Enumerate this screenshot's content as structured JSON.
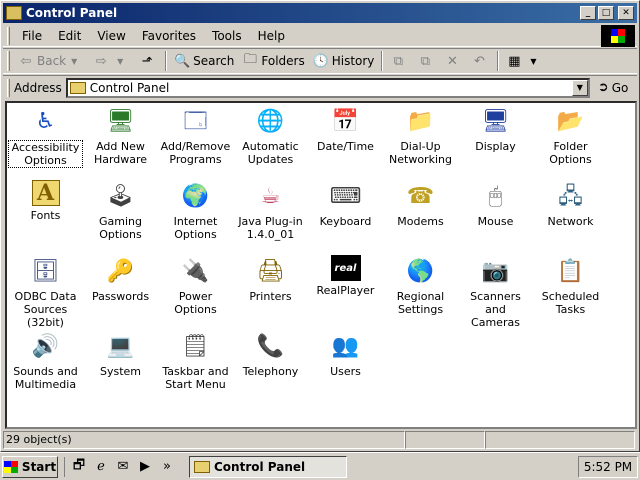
{
  "window": {
    "title": "Control Panel",
    "minimize": "_",
    "maximize": "□",
    "close": "✕"
  },
  "menu": [
    "File",
    "Edit",
    "View",
    "Favorites",
    "Tools",
    "Help"
  ],
  "toolbar": {
    "back": "Back",
    "search": "Search",
    "folders": "Folders",
    "history": "History"
  },
  "address": {
    "label": "Address",
    "value": "Control Panel",
    "go": "Go"
  },
  "icons": [
    {
      "label": "Accessibility Options",
      "glyph": "♿",
      "color": "#1a4fc0"
    },
    {
      "label": "Add New Hardware",
      "glyph": "🖥",
      "color": "#2a7a2a"
    },
    {
      "label": "Add/Remove Programs",
      "glyph": "🗔",
      "color": "#3050a0"
    },
    {
      "label": "Automatic Updates",
      "glyph": "🌐",
      "color": "#2070c0"
    },
    {
      "label": "Date/Time",
      "glyph": "📅",
      "color": "#a02020"
    },
    {
      "label": "Dial-Up Networking",
      "glyph": "📁",
      "color": "#c0a020"
    },
    {
      "label": "Display",
      "glyph": "🖥",
      "color": "#2040a0"
    },
    {
      "label": "Folder Options",
      "glyph": "📂",
      "color": "#c0a020"
    },
    {
      "label": "Fonts",
      "glyph": "A",
      "color": "#806000"
    },
    {
      "label": "Gaming Options",
      "glyph": "🕹",
      "color": "#404040"
    },
    {
      "label": "Internet Options",
      "glyph": "🌍",
      "color": "#2070c0"
    },
    {
      "label": "Java Plug-in 1.4.0_01",
      "glyph": "☕",
      "color": "#c04060"
    },
    {
      "label": "Keyboard",
      "glyph": "⌨",
      "color": "#404040"
    },
    {
      "label": "Modems",
      "glyph": "☎",
      "color": "#c0a020"
    },
    {
      "label": "Mouse",
      "glyph": "🖱",
      "color": "#606060"
    },
    {
      "label": "Network",
      "glyph": "🖧",
      "color": "#306080"
    },
    {
      "label": "ODBC Data Sources (32bit)",
      "glyph": "🗄",
      "color": "#405080"
    },
    {
      "label": "Passwords",
      "glyph": "🔑",
      "color": "#a08000"
    },
    {
      "label": "Power Options",
      "glyph": "🔌",
      "color": "#208020"
    },
    {
      "label": "Printers",
      "glyph": "🖨",
      "color": "#806000"
    },
    {
      "label": "RealPlayer",
      "glyph": "real",
      "color": "#1a3a80"
    },
    {
      "label": "Regional Settings",
      "glyph": "🌎",
      "color": "#2080c0"
    },
    {
      "label": "Scanners and Cameras",
      "glyph": "📷",
      "color": "#806000"
    },
    {
      "label": "Scheduled Tasks",
      "glyph": "📋",
      "color": "#c02020"
    },
    {
      "label": "Sounds and Multimedia",
      "glyph": "🔊",
      "color": "#c0a020"
    },
    {
      "label": "System",
      "glyph": "💻",
      "color": "#306080"
    },
    {
      "label": "Taskbar and Start Menu",
      "glyph": "🗒",
      "color": "#404040"
    },
    {
      "label": "Telephony",
      "glyph": "📞",
      "color": "#404040"
    },
    {
      "label": "Users",
      "glyph": "👥",
      "color": "#204080"
    }
  ],
  "status": {
    "count": "29 object(s)"
  },
  "taskbar": {
    "start": "Start",
    "task": "Control Panel",
    "clock": "5:52 PM",
    "more": "»"
  }
}
